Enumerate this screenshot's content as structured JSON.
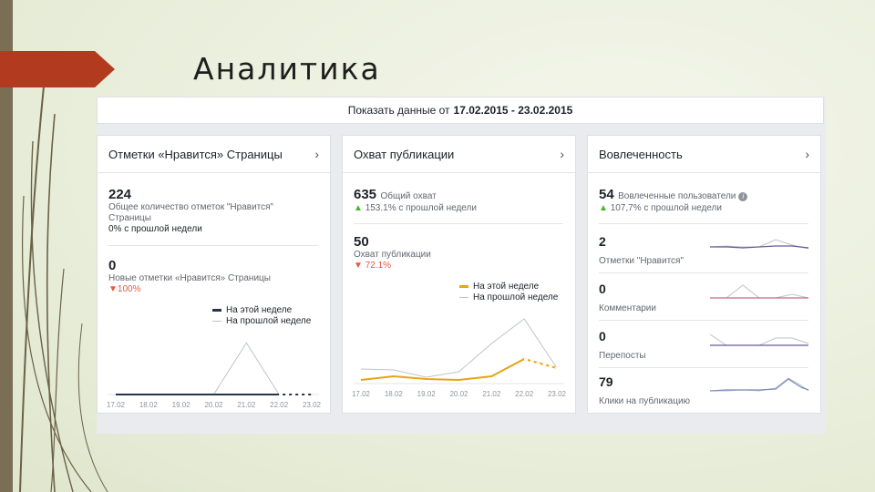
{
  "slide": {
    "title": "Аналитика"
  },
  "date_bar": {
    "prefix": "Показать данные от",
    "range": "17.02.2015 - 23.02.2015"
  },
  "colors": {
    "this_week": "#23344d",
    "last_week": "#bec3c9",
    "reach_this_week": "#e7a415",
    "accent_red": "#b23a1f"
  },
  "likes_card": {
    "title": "Отметки «Нравится» Страницы",
    "total_value": "224",
    "total_label": "Общее количество отметок \"Нравится\" Страницы",
    "total_change": "0% с прошлой недели",
    "new_value": "0",
    "new_label": "Новые отметки «Нравится» Страницы",
    "new_change": "100%",
    "legend_this": "На этой неделе",
    "legend_last": "На прошлой неделе"
  },
  "reach_card": {
    "title": "Охват публикации",
    "total_value": "635",
    "total_label": "Общий охват",
    "total_change": "153.1% с прошлой недели",
    "post_value": "50",
    "post_label": "Охват публикации",
    "post_change": "72.1%",
    "legend_this": "На этой неделе",
    "legend_last": "На прошлой неделе"
  },
  "engagement_card": {
    "title": "Вовлеченность",
    "total_value": "54",
    "total_label": "Вовлеченные пользователи",
    "total_change": "107,7% с прошлой недели",
    "rows": [
      {
        "value": "2",
        "label": "Отметки \"Нравится\""
      },
      {
        "value": "0",
        "label": "Комментарии"
      },
      {
        "value": "0",
        "label": "Перепосты"
      },
      {
        "value": "79",
        "label": "Клики на публикацию"
      }
    ]
  },
  "chart_data": [
    {
      "type": "line",
      "chart": "likes",
      "x": [
        "17.02",
        "18.02",
        "19.02",
        "20.02",
        "21.02",
        "22.02",
        "23.02"
      ],
      "series": [
        {
          "name": "На этой неделе",
          "values": [
            0,
            0,
            0,
            0,
            0,
            0,
            0
          ]
        },
        {
          "name": "На прошлой неделе",
          "values": [
            0,
            0,
            0,
            0,
            1,
            0,
            0
          ]
        }
      ],
      "ylim": [
        0,
        1.2
      ]
    },
    {
      "type": "line",
      "chart": "reach",
      "x": [
        "17.02",
        "18.02",
        "19.02",
        "20.02",
        "21.02",
        "22.02",
        "23.02"
      ],
      "series": [
        {
          "name": "На этой неделе",
          "values": [
            4,
            8,
            5,
            4,
            8,
            27,
            17
          ]
        },
        {
          "name": "На прошлой неделе",
          "values": [
            16,
            15,
            7,
            13,
            44,
            71,
            17
          ]
        }
      ],
      "ylim": [
        0,
        80
      ]
    }
  ]
}
